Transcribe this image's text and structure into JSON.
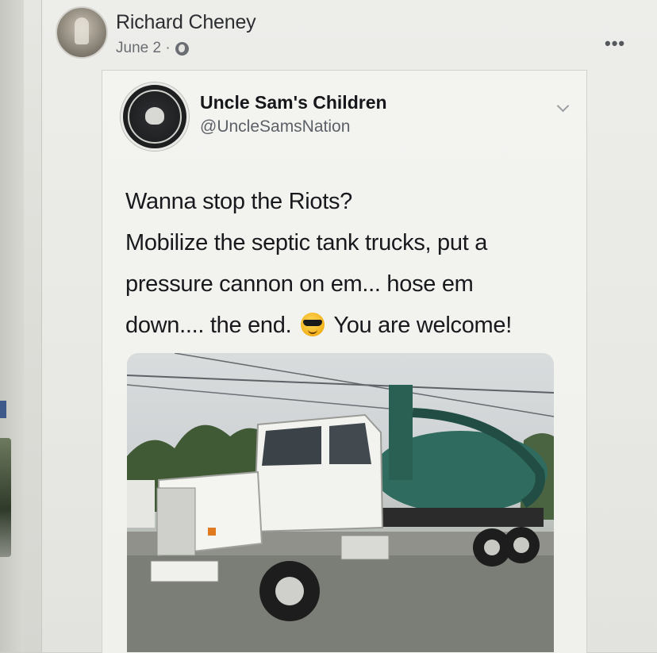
{
  "post": {
    "author_name": "Richard Cheney",
    "date": "June 2 ·",
    "more_label": "•••"
  },
  "tweet": {
    "display_name": "Uncle Sam's Children",
    "handle": "@UncleSamsNation",
    "text_lines": [
      "Wanna stop the Riots?",
      "Mobilize the septic tank trucks, put a",
      "pressure cannon on em... hose em",
      "down.... the end."
    ],
    "text_after_emoji": "You are welcome!",
    "emoji": "sunglasses-emoji"
  },
  "colors": {
    "truck_cab": "#f2f2ef",
    "tank": "#2f6b5e"
  }
}
